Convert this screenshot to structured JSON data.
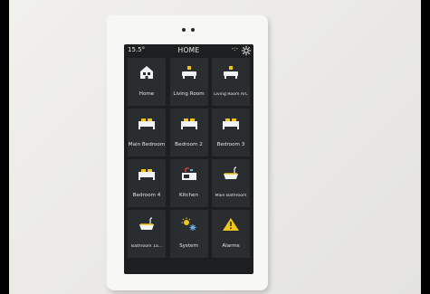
{
  "status": {
    "temperature": "15.5°",
    "title": "HOME",
    "indicator": "-:-"
  },
  "tiles": [
    {
      "label": "Home",
      "icon": "house-icon"
    },
    {
      "label": "Living Room",
      "icon": "sofa-icon"
    },
    {
      "label": "Living Room A/C",
      "icon": "sofa-icon"
    },
    {
      "label": "Main Bedroom",
      "icon": "bed-icon"
    },
    {
      "label": "Bedroom 2",
      "icon": "bed-icon"
    },
    {
      "label": "Bedroom 3",
      "icon": "bed-icon"
    },
    {
      "label": "Bedroom 4",
      "icon": "bed-icon"
    },
    {
      "label": "Kitchen",
      "icon": "kitchen-sink-icon"
    },
    {
      "label": "Main Bathroom",
      "icon": "bathtub-icon"
    },
    {
      "label": "Bathroom 1a...",
      "icon": "bathtub-icon"
    },
    {
      "label": "System",
      "icon": "sun-snowflake-icon"
    },
    {
      "label": "Alarms",
      "icon": "warning-icon"
    }
  ],
  "colors": {
    "screen": "#1c1e20",
    "tile": "#2a2d30",
    "icon_white": "#f2f2f2",
    "accent_yellow": "#f0c419",
    "accent_red": "#d9382e",
    "accent_blue": "#6fb7e8"
  }
}
